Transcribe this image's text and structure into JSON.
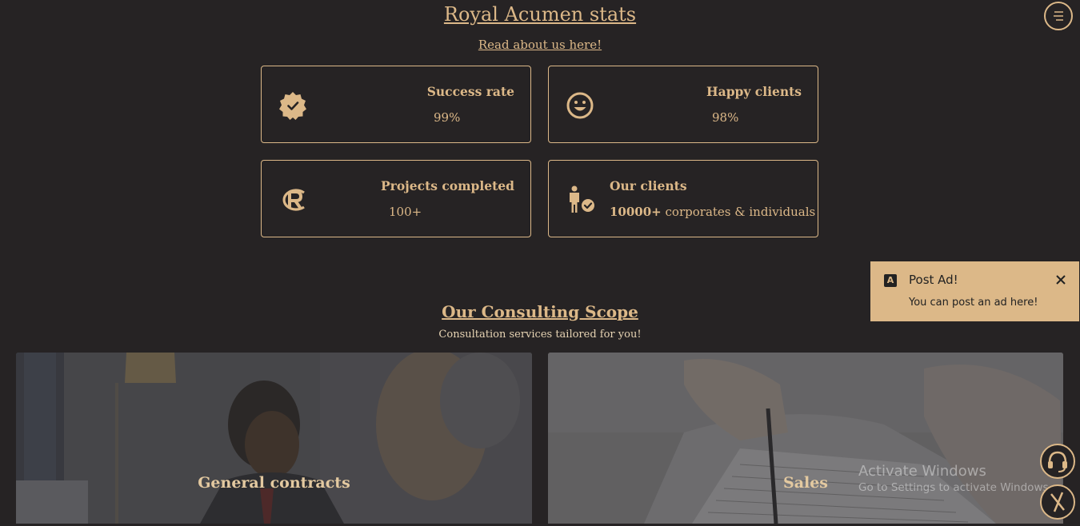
{
  "header": {
    "title": "Royal Acumen stats",
    "about_link": "Read about us here!"
  },
  "stats": [
    {
      "label": "Success rate",
      "value": "99%",
      "icon": "badge-check-icon"
    },
    {
      "label": "Happy clients",
      "value": "98%",
      "icon": "smiley-icon"
    },
    {
      "label": "Projects completed",
      "value": "100+",
      "icon": "registered-icon"
    },
    {
      "label": "Our clients",
      "value_bold": "10000+",
      "value_rest": " corporates & individuals",
      "icon": "person-check-icon"
    }
  ],
  "scope": {
    "title": "Our Consulting Scope",
    "subtitle": "Consultation services tailored for you!",
    "tiles": [
      {
        "caption": "General contracts"
      },
      {
        "caption": "Sales"
      }
    ]
  },
  "toast": {
    "logo": "A",
    "title": "Post Ad!",
    "message": "You can post an ad here!"
  },
  "watermark": {
    "line1": "Activate Windows",
    "line2": "Go to Settings to activate Windows."
  },
  "colors": {
    "accent": "#dcb888",
    "background": "#262324"
  }
}
